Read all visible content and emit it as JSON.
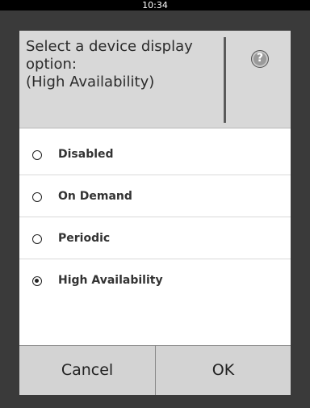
{
  "status_bar": {
    "time": "10:34"
  },
  "dialog": {
    "title": "Select a device display option:\n(High Availability)",
    "help_icon": "question-mark-circle",
    "options": [
      {
        "label": "Disabled",
        "selected": false
      },
      {
        "label": "On Demand",
        "selected": false
      },
      {
        "label": "Periodic",
        "selected": false
      },
      {
        "label": "High Availability",
        "selected": true
      }
    ],
    "buttons": {
      "cancel": "Cancel",
      "ok": "OK"
    }
  }
}
